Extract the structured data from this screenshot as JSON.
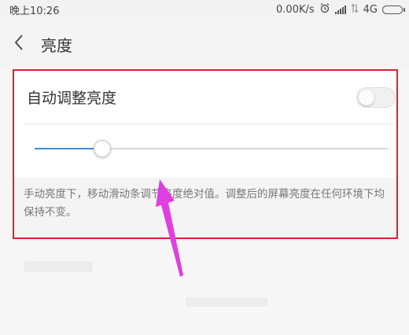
{
  "status_bar": {
    "time": "晚上10:26",
    "speed": "0.00K/s",
    "network": "4G"
  },
  "header": {
    "title": "亮度"
  },
  "auto_brightness": {
    "label": "自动调整亮度",
    "enabled": false
  },
  "brightness_slider": {
    "value": 0.19
  },
  "description": "手动亮度下，移动滑动条调节亮度绝对值。调整后的屏幕亮度在任何环境下均保持不变。",
  "colors": {
    "accent": "#3e8ed6",
    "highlight_box": "#e02030",
    "arrow": "#e03fe0"
  },
  "icons": [
    "back-arrow-icon",
    "alarm-icon",
    "signal-icon",
    "data-transfer-icon",
    "battery-icon"
  ]
}
